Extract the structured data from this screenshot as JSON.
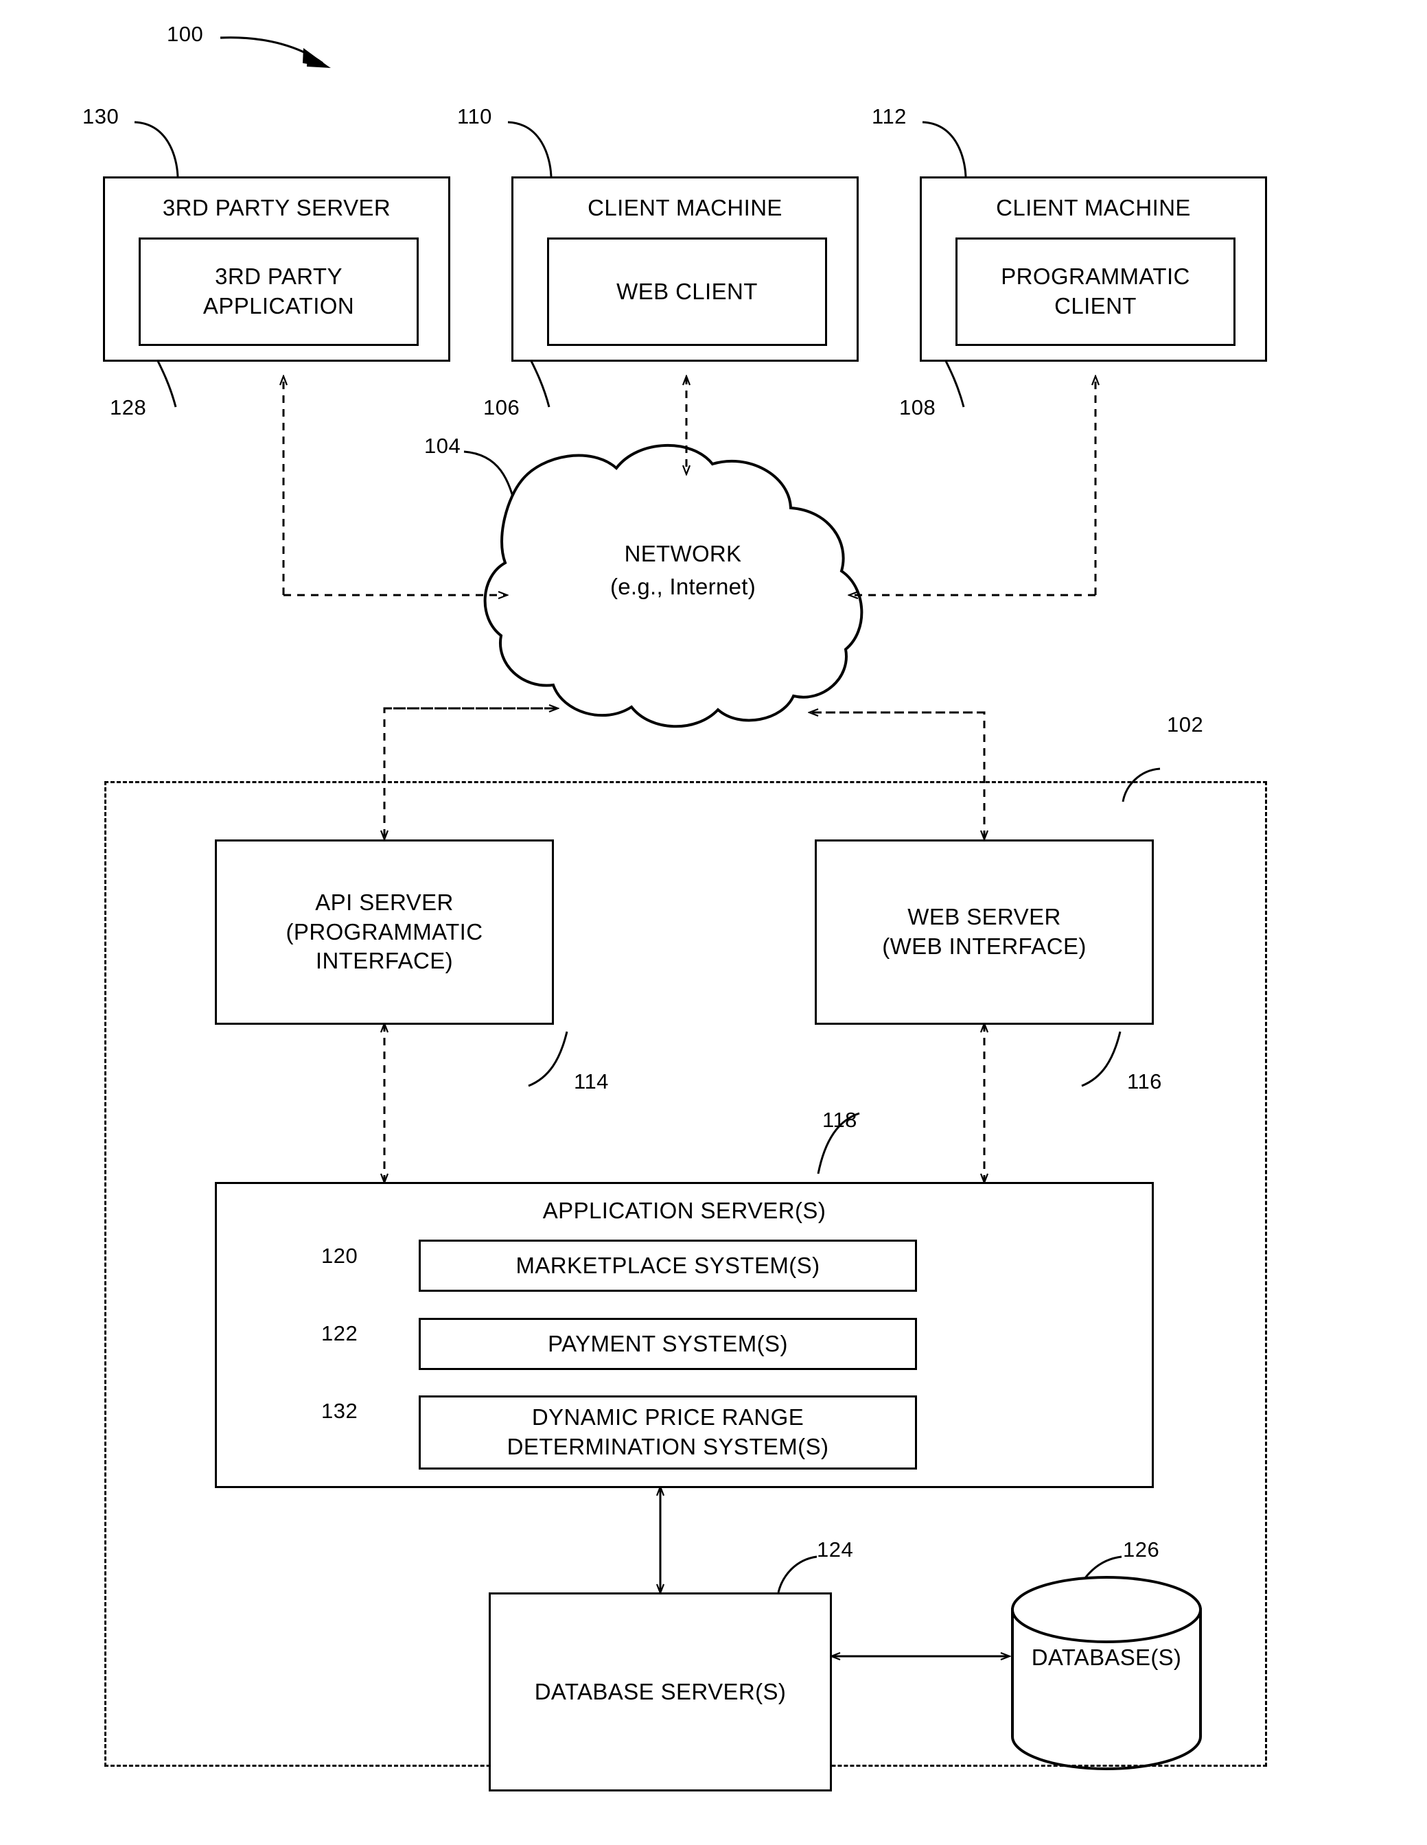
{
  "figure": {
    "system_ref": "100",
    "networked_system_ref": "102"
  },
  "top_row": [
    {
      "ref": "130",
      "title": "3RD PARTY SERVER",
      "inner_ref": "128",
      "inner_label": "3RD PARTY APPLICATION",
      "inner_label_line1": "3RD PARTY",
      "inner_label_line2": "APPLICATION"
    },
    {
      "ref": "110",
      "title": "CLIENT MACHINE",
      "inner_ref": "106",
      "inner_label": "WEB CLIENT",
      "inner_label_line1": "WEB CLIENT",
      "inner_label_line2": ""
    },
    {
      "ref": "112",
      "title": "CLIENT MACHINE",
      "inner_ref": "108",
      "inner_label": "PROGRAMMATIC CLIENT",
      "inner_label_line1": "PROGRAMMATIC",
      "inner_label_line2": "CLIENT"
    }
  ],
  "network": {
    "ref": "104",
    "label_line1": "NETWORK",
    "label_line2": "(e.g., Internet)"
  },
  "servers": {
    "api_server": {
      "ref": "114",
      "line1": "API SERVER",
      "line2": "(PROGRAMMATIC",
      "line3": "INTERFACE)"
    },
    "web_server": {
      "ref": "116",
      "line1": "WEB SERVER",
      "line2": "(WEB INTERFACE)"
    }
  },
  "application_server": {
    "ref": "118",
    "title": "APPLICATION SERVER(S)",
    "subsystems": [
      {
        "ref": "120",
        "line1": "MARKETPLACE SYSTEM(S)",
        "line2": ""
      },
      {
        "ref": "122",
        "line1": "PAYMENT SYSTEM(S)",
        "line2": ""
      },
      {
        "ref": "132",
        "line1": "DYNAMIC PRICE RANGE",
        "line2": "DETERMINATION SYSTEM(S)"
      }
    ]
  },
  "storage": {
    "database_server": {
      "ref": "124",
      "label": "DATABASE SERVER(S)"
    },
    "database": {
      "ref": "126",
      "label": "DATABASE(S)"
    }
  }
}
